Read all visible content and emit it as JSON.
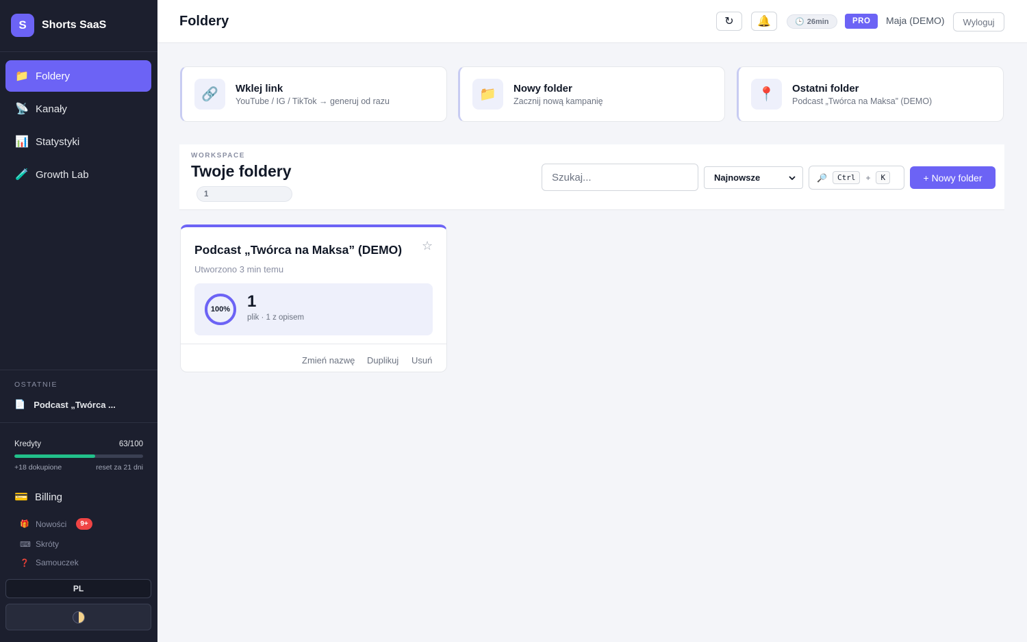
{
  "brand": {
    "logo_letter": "S",
    "name": "Shorts SaaS"
  },
  "nav": [
    {
      "icon": "📁",
      "label": "Foldery",
      "active": true
    },
    {
      "icon": "📡",
      "label": "Kanały"
    },
    {
      "icon": "📊",
      "label": "Statystyki"
    },
    {
      "icon": "🧪",
      "label": "Growth Lab"
    }
  ],
  "recent": {
    "heading": "OSTATNIE",
    "item_icon": "📄",
    "item_label": "Podcast „Twórca ..."
  },
  "credits": {
    "label": "Kredyty",
    "value": "63/100",
    "fraction": 0.63,
    "bought": "+18 dokupione",
    "reset": "reset za 21 dni",
    "bar_color": "#22c08a"
  },
  "billing": {
    "icon": "💳",
    "label": "Billing"
  },
  "minor_links": [
    {
      "icon": "🎁",
      "label": "Nowości",
      "badge": "9+"
    },
    {
      "icon": "⌨",
      "label": "Skróty"
    },
    {
      "icon": "❓",
      "label": "Samouczek"
    }
  ],
  "language": "PL",
  "header": {
    "title": "Foldery",
    "refresh_icon": "↻",
    "bell_icon": "🔔",
    "timer": "26min",
    "timer_icon": "🕒",
    "plan": "PRO",
    "user": "Maja (DEMO)",
    "logout": "Wyloguj"
  },
  "quick_cards": [
    {
      "icon": "🔗",
      "title": "Wklej link",
      "subtitle": "YouTube / IG / TikTok → generuj od razu"
    },
    {
      "icon": "📁",
      "title": "Nowy folder",
      "subtitle": "Zacznij nową kampanię"
    },
    {
      "icon": "📍",
      "title": "Ostatni folder",
      "subtitle": "Podcast „Twórca na Maksa” (DEMO)"
    }
  ],
  "workspace": {
    "kicker": "WORKSPACE",
    "title": "Twoje foldery",
    "count": "1",
    "search_placeholder": "Szukaj...",
    "sort_value": "Najnowsze",
    "search_icon": "🔎",
    "shortcut_key1": "Ctrl",
    "shortcut_plus": "+",
    "shortcut_key2": "K",
    "new_folder": "+ Nowy folder"
  },
  "folder_card": {
    "title": "Podcast „Twórca na Maksa” (DEMO)",
    "star": "☆",
    "created": "Utworzono 3 min temu",
    "progress_label": "100%",
    "progress_fraction": 1.0,
    "file_count": "1",
    "files_desc": "plik · 1 z opisem",
    "actions": [
      "Zmień nazwę",
      "Duplikuj",
      "Usuń"
    ]
  },
  "colors": {
    "accent": "#6c63f5",
    "sidebar": "#1c1f2e",
    "badge": "#ef4444"
  }
}
